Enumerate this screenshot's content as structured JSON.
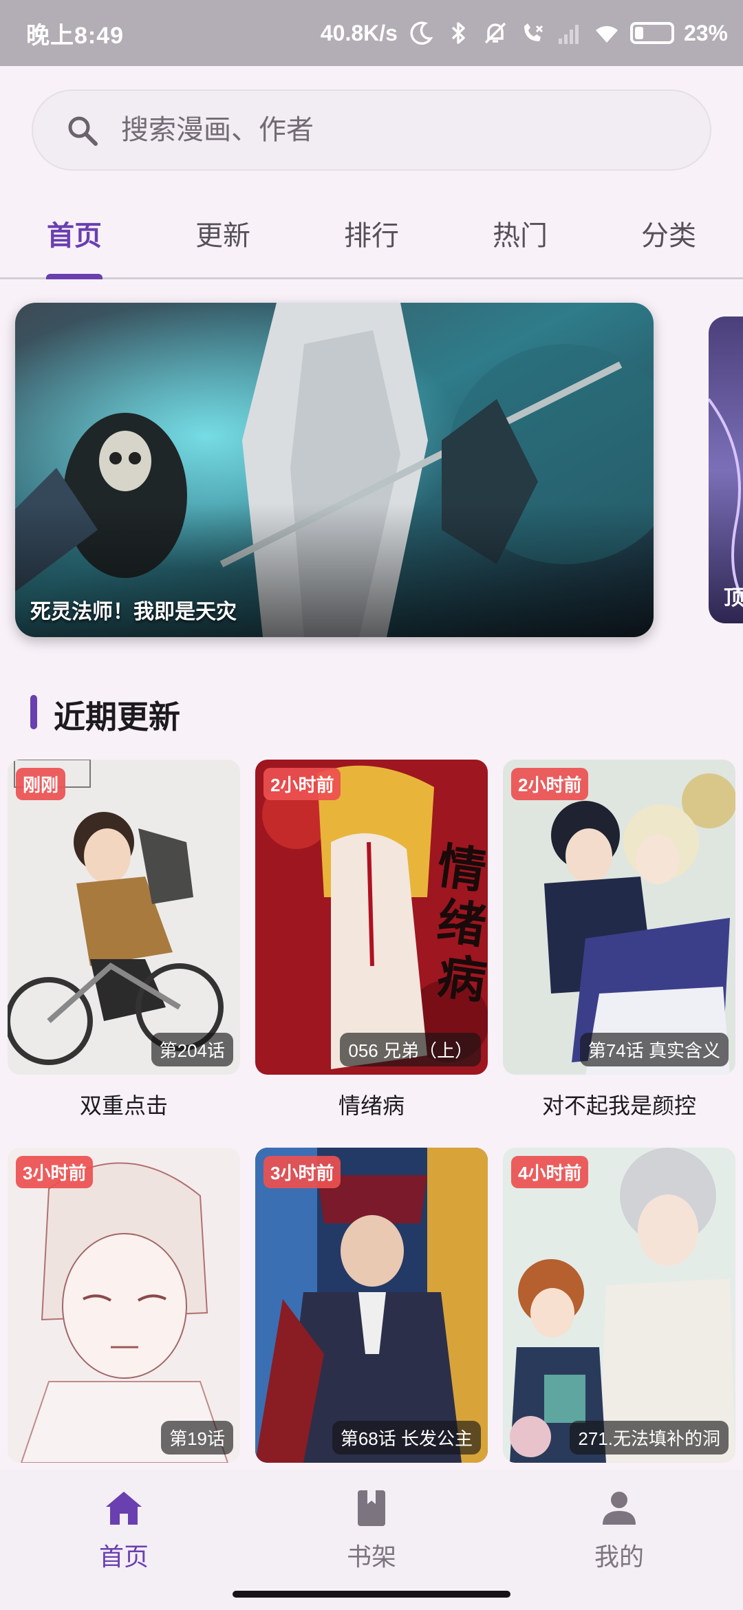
{
  "status_bar": {
    "time": "晚上8:49",
    "net_speed": "40.8K/s",
    "battery": "23%",
    "battery_level": 0.23,
    "icons": [
      "moon-icon",
      "bluetooth-icon",
      "bell-off-icon",
      "call-icon",
      "signal-icon",
      "wifi-icon",
      "battery-icon"
    ]
  },
  "search": {
    "placeholder": "搜索漫画、作者"
  },
  "tabs": [
    {
      "label": "首页",
      "active": true
    },
    {
      "label": "更新",
      "active": false
    },
    {
      "label": "排行",
      "active": false
    },
    {
      "label": "热门",
      "active": false
    },
    {
      "label": "分类",
      "active": false
    }
  ],
  "carousel": {
    "current": {
      "title": "死灵法师！我即是天灾"
    },
    "next": {
      "title": "顶级"
    }
  },
  "recent": {
    "heading": "近期更新",
    "items": [
      {
        "badge": "刚刚",
        "chapter": "第204话",
        "title": "双重点击"
      },
      {
        "badge": "2小时前",
        "chapter": "056 兄弟（上）",
        "title": "情绪病"
      },
      {
        "badge": "2小时前",
        "chapter": "第74话 真实含义",
        "title": "对不起我是颜控"
      },
      {
        "badge": "3小时前",
        "chapter": "第19话",
        "title": ""
      },
      {
        "badge": "3小时前",
        "chapter": "第68话 长发公主",
        "title": ""
      },
      {
        "badge": "4小时前",
        "chapter": "271.无法填补的洞",
        "title": ""
      }
    ]
  },
  "bottom_nav": [
    {
      "label": "首页",
      "icon": "home-icon",
      "active": true
    },
    {
      "label": "书架",
      "icon": "bookshelf-icon",
      "active": false
    },
    {
      "label": "我的",
      "icon": "person-icon",
      "active": false
    }
  ],
  "colors": {
    "accent": "#6a3fb0",
    "background": "#f8f1f8",
    "badge": "#eb5050",
    "status_bar": "#b3adb5"
  }
}
